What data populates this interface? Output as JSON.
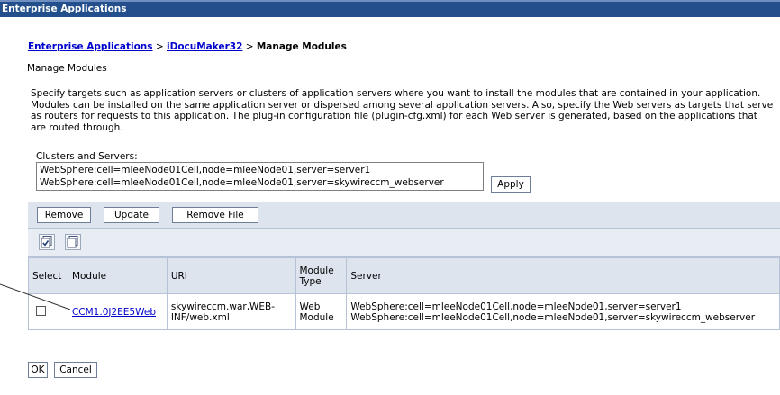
{
  "window": {
    "title": "Enterprise Applications"
  },
  "breadcrumb": {
    "link1": "Enterprise Applications",
    "sep1": " > ",
    "link2": "iDocuMaker32",
    "sep2": " > ",
    "current": "Manage Modules"
  },
  "page": {
    "subtitle": "Manage Modules",
    "description": "Specify targets such as application servers or clusters of application servers where you want to install the modules that are contained in your application. Modules can be installed on the same application server or dispersed among several application servers. Also, specify the Web servers as targets that serve as routers for requests to this application. The plug-in configuration file (plugin-cfg.xml) for each Web server is generated, based on the applications that are routed through."
  },
  "clusters": {
    "label": "Clusters and Servers:",
    "options": [
      "WebSphere:cell=mleeNode01Cell,node=mleeNode01,server=server1",
      "WebSphere:cell=mleeNode01Cell,node=mleeNode01,server=skywireccm_webserver"
    ],
    "apply_label": "Apply"
  },
  "toolbar": {
    "remove_label": "Remove",
    "update_label": "Update",
    "remove_file_label": "Remove File"
  },
  "table": {
    "headers": {
      "select": "Select",
      "module": "Module",
      "uri": "URI",
      "module_type": "Module Type",
      "server": "Server"
    },
    "rows": [
      {
        "module": "CCM1.0J2EE5Web",
        "uri": "skywireccm.war,WEB-INF/web.xml",
        "module_type": "Web Module",
        "server": [
          "WebSphere:cell=mleeNode01Cell,node=mleeNode01,server=server1",
          "WebSphere:cell=mleeNode01Cell,node=mleeNode01,server=skywireccm_webserver"
        ]
      }
    ]
  },
  "footer": {
    "ok_label": "OK",
    "cancel_label": "Cancel"
  }
}
